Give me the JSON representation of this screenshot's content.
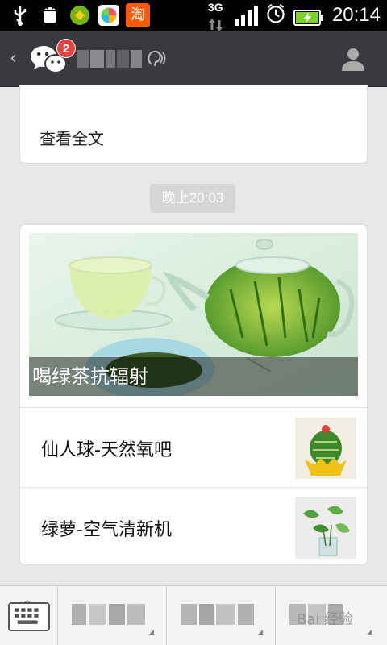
{
  "status_bar": {
    "network": "3G",
    "time": "20:14",
    "icons": [
      "usb-icon",
      "android-debug-icon",
      "app-icon-green",
      "app-icon-colorful",
      "taobao-icon",
      "signal-icon",
      "alarm-icon",
      "battery-charging-icon"
    ],
    "taobao_label": "淘"
  },
  "title_bar": {
    "back_label": "‹",
    "unread_badge": "2",
    "icons": [
      "wechat-icon",
      "earpiece-mode-icon",
      "profile-icon"
    ]
  },
  "messages": {
    "card1": {
      "read_all": "查看全文"
    },
    "timestamp": "晚上20:03",
    "card2": {
      "cover_caption": "喝绿茶抗辐射",
      "items": [
        {
          "title": "仙人球-天然氧吧"
        },
        {
          "title": "绿萝-空气清新机"
        }
      ]
    }
  },
  "bottom_bar": {
    "icons": [
      "keyboard-icon"
    ]
  },
  "watermark": "Bai 经验",
  "colors": {
    "title_bar": "#393a3f",
    "badge": "#e64340",
    "timestamp_bg": "#d6d6d6",
    "background": "#e8e8e8"
  }
}
